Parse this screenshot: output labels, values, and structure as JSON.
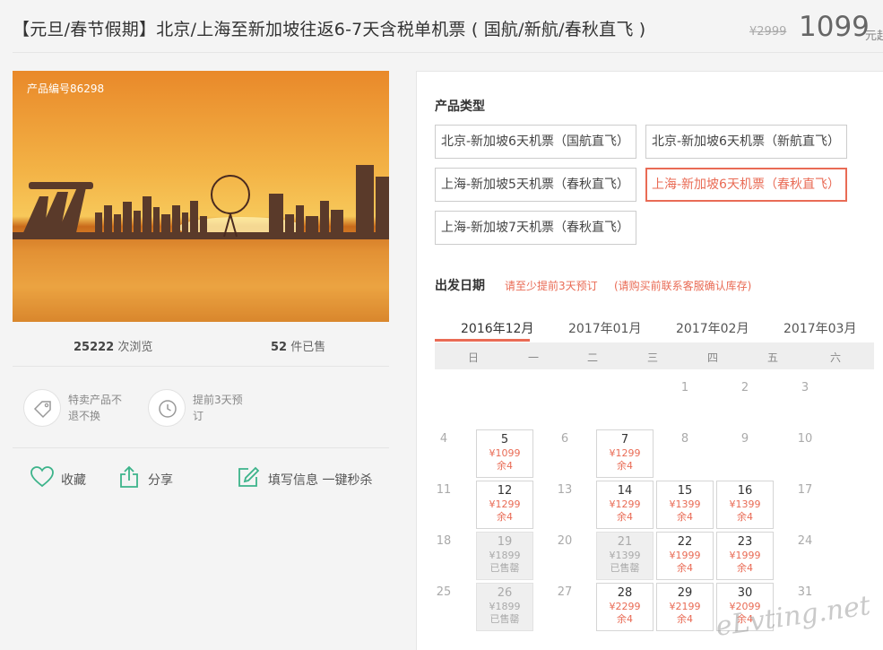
{
  "header": {
    "title": "【元旦/春节假期】北京/上海至新加坡往返6-7天含税单机票 ( 国航/新航/春秋直飞 )",
    "original_price": "¥2999",
    "price": "1099",
    "price_unit": "元起"
  },
  "gallery": {
    "product_no": "产品编号86298"
  },
  "stats": {
    "views_num": "25222",
    "views_label": "次浏览",
    "sold_num": "52",
    "sold_label": "件已售"
  },
  "features": [
    {
      "icon": "tag-icon",
      "line1": "特卖产品不",
      "line2": "退不换"
    },
    {
      "icon": "clock-icon",
      "line1": "提前3天预",
      "line2": "订"
    }
  ],
  "actions": {
    "favorite": "收藏",
    "share": "分享",
    "fill_info": "填写信息 一键秒杀"
  },
  "product_type": {
    "title": "产品类型",
    "options": [
      "北京-新加坡6天机票（国航直飞）",
      "北京-新加坡6天机票（新航直飞）",
      "上海-新加坡5天机票（春秋直飞）",
      "上海-新加坡6天机票（春秋直飞）",
      "上海-新加坡7天机票（春秋直飞）"
    ],
    "selected_index": 3
  },
  "departure": {
    "title": "出发日期",
    "note1": "请至少提前3天预订",
    "note2": "(请购买前联系客服确认库存)",
    "months": [
      "2016年12月",
      "2017年01月",
      "2017年02月",
      "2017年03月"
    ],
    "active_month": "2016年12月",
    "weekdays": [
      "日",
      "一",
      "二",
      "三",
      "四",
      "五",
      "六"
    ],
    "calendar_rows": [
      [
        {
          "d": ""
        },
        {
          "d": ""
        },
        {
          "d": ""
        },
        {
          "d": ""
        },
        {
          "d": "1"
        },
        {
          "d": "2"
        },
        {
          "d": "3"
        }
      ],
      [
        {
          "d": "4"
        },
        {
          "d": "5",
          "p": "¥1099",
          "s": "余4"
        },
        {
          "d": "6"
        },
        {
          "d": "7",
          "p": "¥1299",
          "s": "余4"
        },
        {
          "d": "8"
        },
        {
          "d": "9"
        },
        {
          "d": "10"
        }
      ],
      [
        {
          "d": "11"
        },
        {
          "d": "12",
          "p": "¥1299",
          "s": "余4"
        },
        {
          "d": "13"
        },
        {
          "d": "14",
          "p": "¥1299",
          "s": "余4"
        },
        {
          "d": "15",
          "p": "¥1399",
          "s": "余4"
        },
        {
          "d": "16",
          "p": "¥1399",
          "s": "余4"
        },
        {
          "d": "17"
        }
      ],
      [
        {
          "d": "18"
        },
        {
          "d": "19",
          "p": "¥1899",
          "s": "已售罄",
          "sold": true
        },
        {
          "d": "20"
        },
        {
          "d": "21",
          "p": "¥1399",
          "s": "已售罄",
          "sold": true
        },
        {
          "d": "22",
          "p": "¥1999",
          "s": "余4"
        },
        {
          "d": "23",
          "p": "¥1999",
          "s": "余4"
        },
        {
          "d": "24"
        }
      ],
      [
        {
          "d": "25"
        },
        {
          "d": "26",
          "p": "¥1899",
          "s": "已售罄",
          "sold": true
        },
        {
          "d": "27"
        },
        {
          "d": "28",
          "p": "¥2299",
          "s": "余4"
        },
        {
          "d": "29",
          "p": "¥2199",
          "s": "余4"
        },
        {
          "d": "30",
          "p": "¥2099",
          "s": "余4"
        },
        {
          "d": "31"
        }
      ]
    ]
  },
  "watermark": "eLvting.net",
  "colors": {
    "accent": "#e96b55",
    "icon_green": "#3cb38a"
  }
}
